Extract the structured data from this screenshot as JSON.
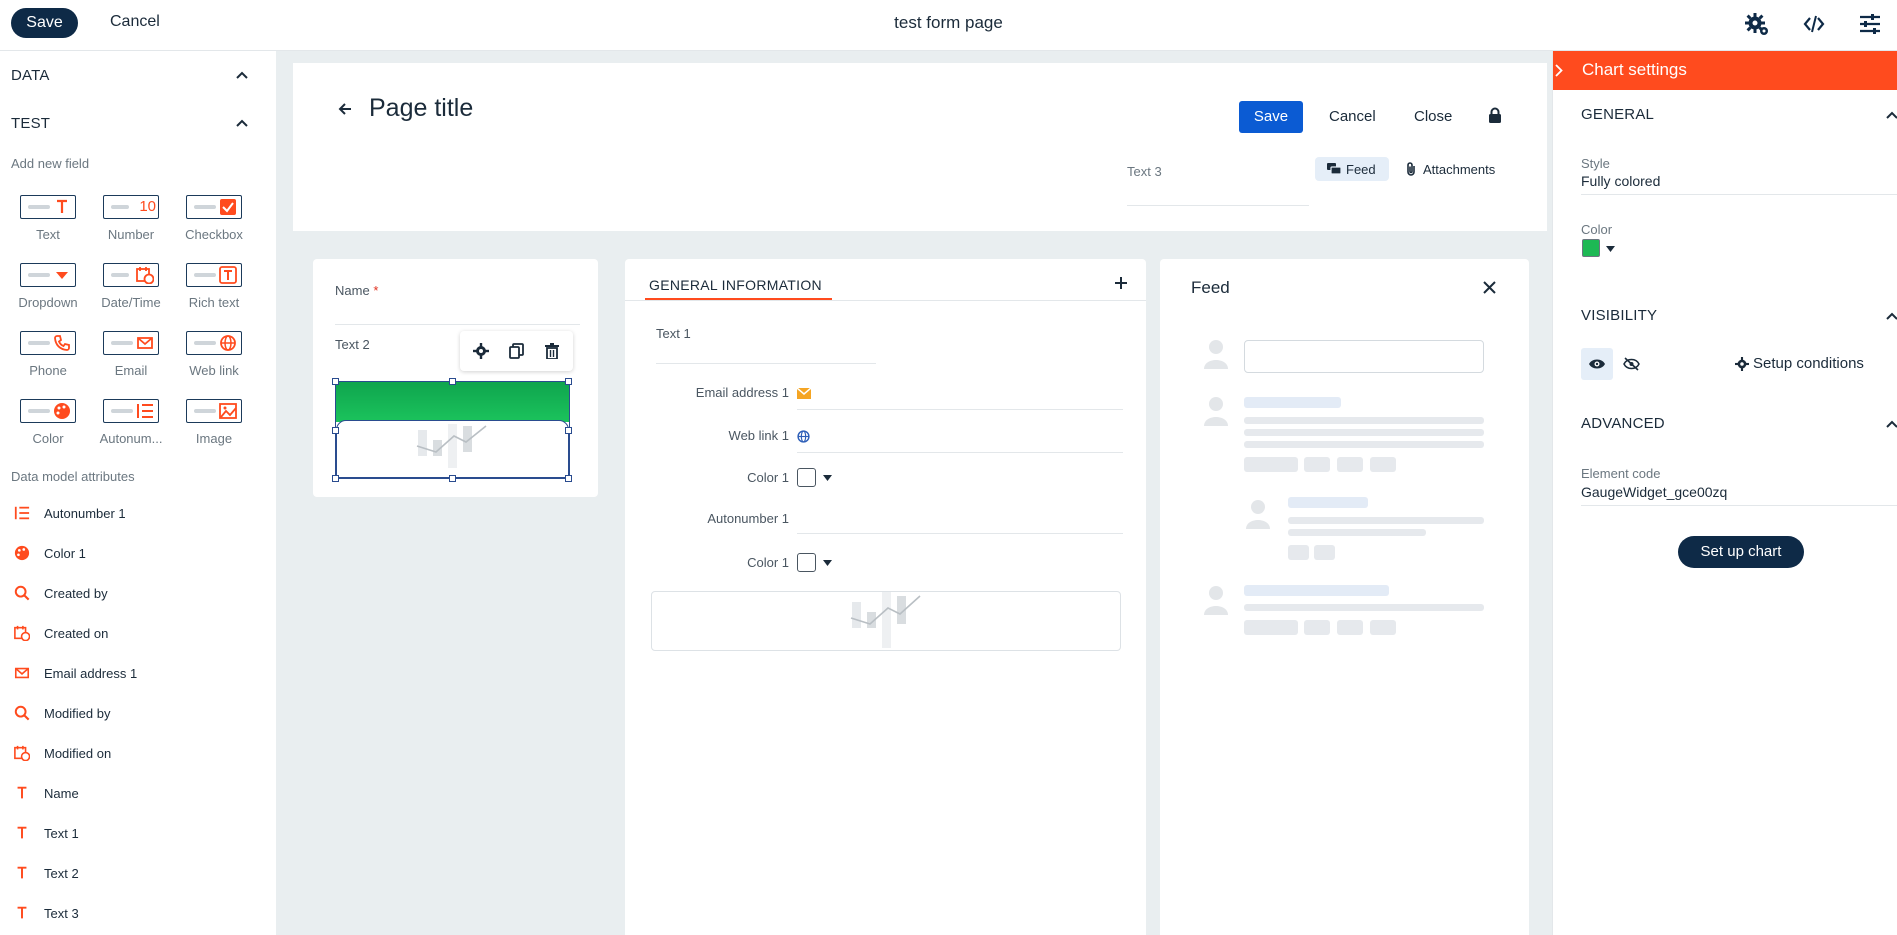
{
  "topbar": {
    "save_label": "Save",
    "cancel_label": "Cancel",
    "title": "test form page"
  },
  "sidebar": {
    "section_data": "DATA",
    "section_test": "TEST",
    "add_new_field": "Add new field",
    "tiles": [
      "Text",
      "Number",
      "Checkbox",
      "Dropdown",
      "Date/Time",
      "Rich text",
      "Phone",
      "Email",
      "Web link",
      "Color",
      "Autonum...",
      "Image"
    ],
    "number_glyph": "10",
    "data_model_label": "Data model attributes",
    "attributes": [
      "Autonumber 1",
      "Color 1",
      "Created by",
      "Created on",
      "Email address 1",
      "Modified by",
      "Modified on",
      "Name",
      "Text 1",
      "Text 2",
      "Text 3"
    ]
  },
  "page": {
    "title": "Page title",
    "save_label": "Save",
    "cancel_label": "Cancel",
    "close_label": "Close",
    "text3_label": "Text 3",
    "feed_tab": "Feed",
    "attachments_tab": "Attachments"
  },
  "left_card": {
    "name_label": "Name",
    "required_mark": "*",
    "text2_label": "Text 2"
  },
  "general_card": {
    "tab_label": "GENERAL INFORMATION",
    "text1_label": "Text 1",
    "email_label": "Email address 1",
    "weblink_label": "Web link 1",
    "color1_label": "Color 1",
    "autonumber_label": "Autonumber 1",
    "color1b_label": "Color 1"
  },
  "feed_card": {
    "title": "Feed"
  },
  "right_panel": {
    "header": "Chart settings",
    "general": "GENERAL",
    "style_label": "Style",
    "style_value": "Fully colored",
    "color_label": "Color",
    "color_value": "#1db954",
    "visibility": "VISIBILITY",
    "setup_conditions": "Setup conditions",
    "advanced": "ADVANCED",
    "element_code_label": "Element code",
    "element_code_value": "GaugeWidget_gce00zq",
    "setup_chart_button": "Set up chart"
  },
  "colors": {
    "accent": "#ff4b1e",
    "navy": "#0e2a47",
    "primary_blue": "#0b5bd3",
    "gauge_green": "#1db954"
  }
}
